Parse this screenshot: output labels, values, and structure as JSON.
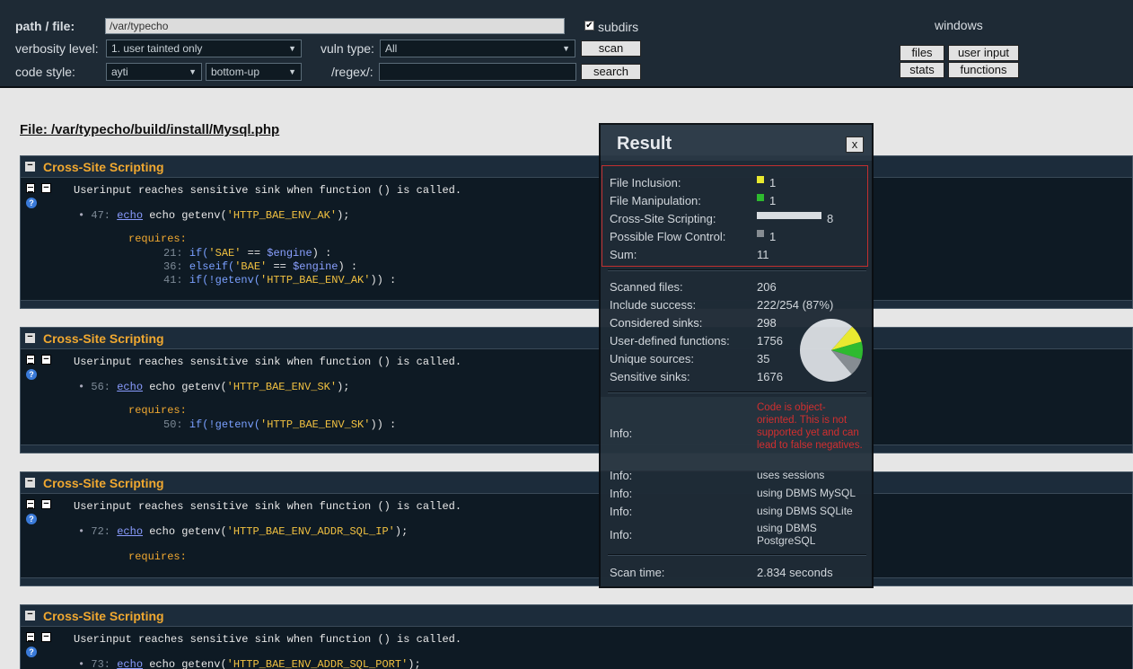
{
  "header": {
    "path_label": "path / file:",
    "path_value": "/var/typecho",
    "subdirs_label": "subdirs",
    "verbosity_label": "verbosity level:",
    "verbosity_value": "1. user tainted only",
    "vulntype_label": "vuln type:",
    "vulntype_value": "All",
    "scan_label": "scan",
    "codestyle_label": "code style:",
    "codestyle_value": "ayti",
    "order_value": "bottom-up",
    "regex_label": "/regex/:",
    "regex_value": "",
    "search_label": "search",
    "windows_label": "windows",
    "files_label": "files",
    "userinput_label": "user input",
    "stats_label": "stats",
    "functions_label": "functions"
  },
  "file_title": "File: /var/typecho/build/install/Mysql.php",
  "vulns": [
    {
      "title": "Cross-Site Scripting",
      "desc": "Userinput reaches sensitive sink when function () is called.",
      "line": "47:",
      "echo": "echo",
      "code_pre": " echo getenv(",
      "code_str": "'HTTP_BAE_ENV_AK'",
      "code_post": ");",
      "requires": "requires:",
      "reqs": [
        {
          "ln": "21:",
          "pre": "if(",
          "str": "'SAE'",
          "mid": " == ",
          "var": "$engine",
          "post": ") :"
        },
        {
          "ln": "36:",
          "pre": "elseif(",
          "str": "'BAE'",
          "mid": " == ",
          "var": "$engine",
          "post": ") :"
        },
        {
          "ln": "41:",
          "pre": "if(!getenv(",
          "str": "'HTTP_BAE_ENV_AK'",
          "mid": "",
          "var": "",
          "post": ")) :"
        }
      ]
    },
    {
      "title": "Cross-Site Scripting",
      "desc": "Userinput reaches sensitive sink when function () is called.",
      "line": "56:",
      "echo": "echo",
      "code_pre": " echo getenv(",
      "code_str": "'HTTP_BAE_ENV_SK'",
      "code_post": ");",
      "requires": "requires:",
      "reqs": [
        {
          "ln": "50:",
          "pre": "if(!getenv(",
          "str": "'HTTP_BAE_ENV_SK'",
          "mid": "",
          "var": "",
          "post": ")) :"
        }
      ]
    },
    {
      "title": "Cross-Site Scripting",
      "desc": "Userinput reaches sensitive sink when function () is called.",
      "line": "72:",
      "echo": "echo",
      "code_pre": " echo getenv(",
      "code_str": "'HTTP_BAE_ENV_ADDR_SQL_IP'",
      "code_post": ");",
      "requires": "requires:",
      "reqs": []
    },
    {
      "title": "Cross-Site Scripting",
      "desc": "Userinput reaches sensitive sink when function () is called.",
      "line": "73:",
      "echo": "echo",
      "code_pre": " echo getenv(",
      "code_str": "'HTTP_BAE_ENV_ADDR_SQL_PORT'",
      "code_post": ");",
      "requires": "",
      "reqs": []
    }
  ],
  "result": {
    "title": "Result",
    "close": "x",
    "counts": [
      {
        "label": "File Inclusion:",
        "value": "1",
        "color": "#f0f030"
      },
      {
        "label": "File Manipulation:",
        "value": "1",
        "color": "#30c030"
      },
      {
        "label": "Cross-Site Scripting:",
        "value": "8",
        "color": "#e0e4e8"
      },
      {
        "label": "Possible Flow Control:",
        "value": "1",
        "color": "#8a9096"
      },
      {
        "label": "Sum:",
        "value": "11",
        "color": ""
      }
    ],
    "stats": [
      {
        "label": "Scanned files:",
        "value": "206"
      },
      {
        "label": "Include success:",
        "value": "222/254 (87%)"
      },
      {
        "label": "Considered sinks:",
        "value": "298"
      },
      {
        "label": "User-defined functions:",
        "value": "1756"
      },
      {
        "label": "Unique sources:",
        "value": "35"
      },
      {
        "label": "Sensitive sinks:",
        "value": "1676"
      }
    ],
    "pie_shares": [
      {
        "name": "Cross-Site Scripting",
        "value": 8,
        "color": "#d8dce0"
      },
      {
        "name": "File Inclusion",
        "value": 1,
        "color": "#f0f030"
      },
      {
        "name": "File Manipulation",
        "value": 1,
        "color": "#30c030"
      },
      {
        "name": "Possible Flow Control",
        "value": 1,
        "color": "#8a9096"
      }
    ],
    "infos": [
      {
        "label": "Info:",
        "value": "Code is object-oriented. This is not supported yet and can lead to false negatives."
      },
      {
        "label": "Info:",
        "value": "uses sessions"
      },
      {
        "label": "Info:",
        "value": "using DBMS MySQL"
      },
      {
        "label": "Info:",
        "value": "using DBMS SQLite"
      },
      {
        "label": "Info:",
        "value": "using DBMS PostgreSQL"
      }
    ],
    "scantime_label": "Scan time:",
    "scantime_value": "2.834 seconds"
  },
  "colors": {
    "header_bg": "#1e2a35",
    "vuln_title": "#f0a830",
    "code_string": "#f0c040",
    "highlight_border": "#c83030"
  }
}
